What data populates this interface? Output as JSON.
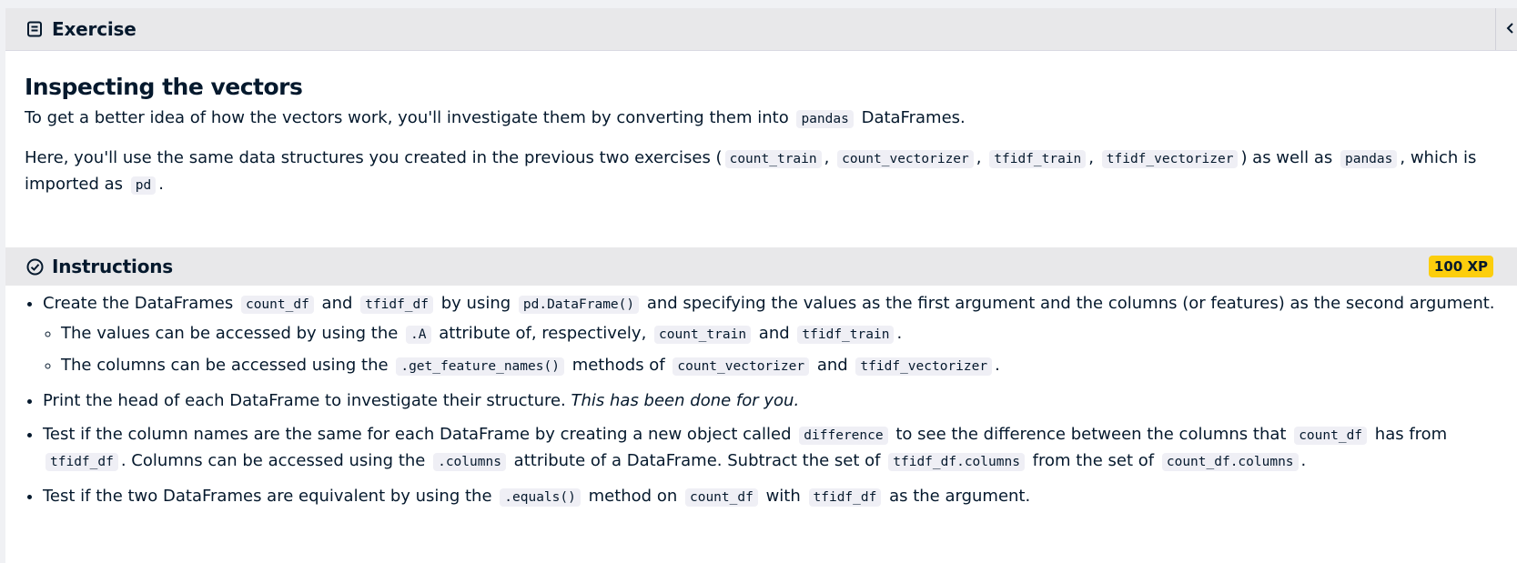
{
  "exercise": {
    "header_label": "Exercise",
    "title": "Inspecting the vectors",
    "p1": {
      "t1": "To get a better idea of how the vectors work, you'll investigate them by converting them into",
      "c1": "pandas",
      "t2": "DataFrames."
    },
    "p2": {
      "t1": "Here, you'll use the same data structures you created in the previous two exercises (",
      "c1": "count_train",
      "s1": ",",
      "c2": "count_vectorizer",
      "s2": ",",
      "c3": "tfidf_train",
      "s3": ",",
      "c4": "tfidf_vectorizer",
      "t2": ") as well as",
      "c5": "pandas",
      "t3": ", which is imported as",
      "c6": "pd",
      "t4": "."
    }
  },
  "instructions": {
    "header_label": "Instructions",
    "xp": "100 XP",
    "b1": {
      "t1": "Create the DataFrames",
      "c1": "count_df",
      "t2": "and",
      "c2": "tfidf_df",
      "t3": "by using",
      "c3": "pd.DataFrame()",
      "t4": "and specifying the values as the first argument and the columns (or features) as the second argument."
    },
    "sub1": {
      "t1": "The values can be accessed by using the",
      "c1": ".A",
      "t2": "attribute of, respectively,",
      "c2": "count_train",
      "t3": "and",
      "c3": "tfidf_train",
      "t4": "."
    },
    "sub2": {
      "t1": "The columns can be accessed using the",
      "c1": ".get_feature_names()",
      "t2": "methods of",
      "c2": "count_vectorizer",
      "t3": "and",
      "c3": "tfidf_vectorizer",
      "t4": "."
    },
    "b2": {
      "t1": "Print the head of each DataFrame to investigate their structure.",
      "em": "This has been done for you."
    },
    "b3": {
      "t1": "Test if the column names are the same for each DataFrame by creating a new object called",
      "c1": "difference",
      "t2": "to see the difference between the columns that",
      "c2": "count_df",
      "t3": "has from",
      "c3": "tfidf_df",
      "t4": ". Columns can be accessed using the",
      "c4": ".columns",
      "t5": "attribute of a DataFrame. Subtract the set of",
      "c5": "tfidf_df.columns",
      "t6": "from the set of",
      "c6": "count_df.columns",
      "t7": "."
    },
    "b4": {
      "t1": "Test if the two DataFrames are equivalent by using the",
      "c1": ".equals()",
      "t2": "method on",
      "c2": "count_df",
      "t3": "with",
      "c3": "tfidf_df",
      "t4": "as the argument."
    }
  },
  "icons": {
    "exercise": "document-icon",
    "instructions": "check-circle-icon",
    "collapse": "chevron-left-icon"
  },
  "colors": {
    "header_bg": "#e8e8ea",
    "xp_badge": "#fcce0d",
    "text": "#05192d",
    "code_bg": "#efeff5"
  }
}
